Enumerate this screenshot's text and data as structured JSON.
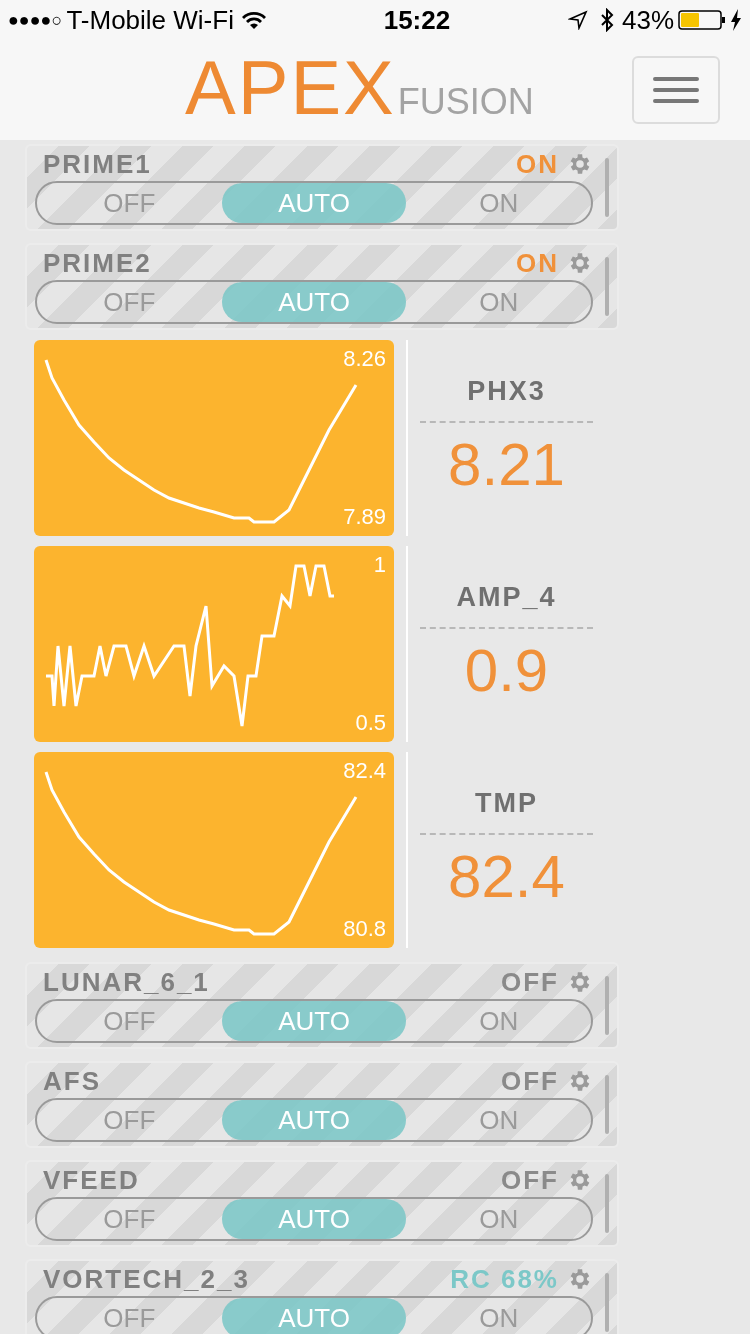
{
  "status_bar": {
    "signal": "●●●●○",
    "carrier": "T-Mobile Wi-Fi",
    "time": "15:22",
    "battery": "43%"
  },
  "header": {
    "logo_main": "APEX",
    "logo_sub": "FUSION"
  },
  "outlets_top": [
    {
      "name": "PRIME1",
      "status": "ON",
      "color": "#f0913a",
      "modes": [
        {
          "label": "OFF",
          "selected": false
        },
        {
          "label": "AUTO",
          "selected": true
        },
        {
          "label": "ON",
          "selected": false
        }
      ]
    },
    {
      "name": "PRIME2",
      "status": "ON",
      "color": "#f0913a",
      "modes": [
        {
          "label": "OFF",
          "selected": false
        },
        {
          "label": "AUTO",
          "selected": true
        },
        {
          "label": "ON",
          "selected": false
        }
      ]
    }
  ],
  "probes": [
    {
      "name": "PHX3",
      "value": "8.21",
      "max": "8.26",
      "min": "7.89",
      "kind": "valley"
    },
    {
      "name": "AMP_4",
      "value": "0.9",
      "max": "1",
      "min": "0.5",
      "kind": "noisy"
    },
    {
      "name": "TMP",
      "value": "82.4",
      "max": "82.4",
      "min": "80.8",
      "kind": "valley"
    }
  ],
  "outlets_bottom": [
    {
      "name": "LUNAR_6_1",
      "status": "OFF",
      "color": "#8a8a8a",
      "modes": [
        {
          "label": "OFF",
          "selected": false
        },
        {
          "label": "AUTO",
          "selected": true
        },
        {
          "label": "ON",
          "selected": false
        }
      ]
    },
    {
      "name": "AFS",
      "status": "OFF",
      "color": "#8a8a8a",
      "modes": [
        {
          "label": "OFF",
          "selected": false
        },
        {
          "label": "AUTO",
          "selected": true
        },
        {
          "label": "ON",
          "selected": false
        }
      ]
    },
    {
      "name": "VFEED",
      "status": "OFF",
      "color": "#8a8a8a",
      "modes": [
        {
          "label": "OFF",
          "selected": false
        },
        {
          "label": "AUTO",
          "selected": true
        },
        {
          "label": "ON",
          "selected": false
        }
      ]
    },
    {
      "name": "VORTECH_2_3",
      "status": "RC 68%",
      "color": "#7cc8c8",
      "modes": [
        {
          "label": "OFF",
          "selected": false
        },
        {
          "label": "AUTO",
          "selected": true
        },
        {
          "label": "ON",
          "selected": false
        }
      ]
    }
  ]
}
